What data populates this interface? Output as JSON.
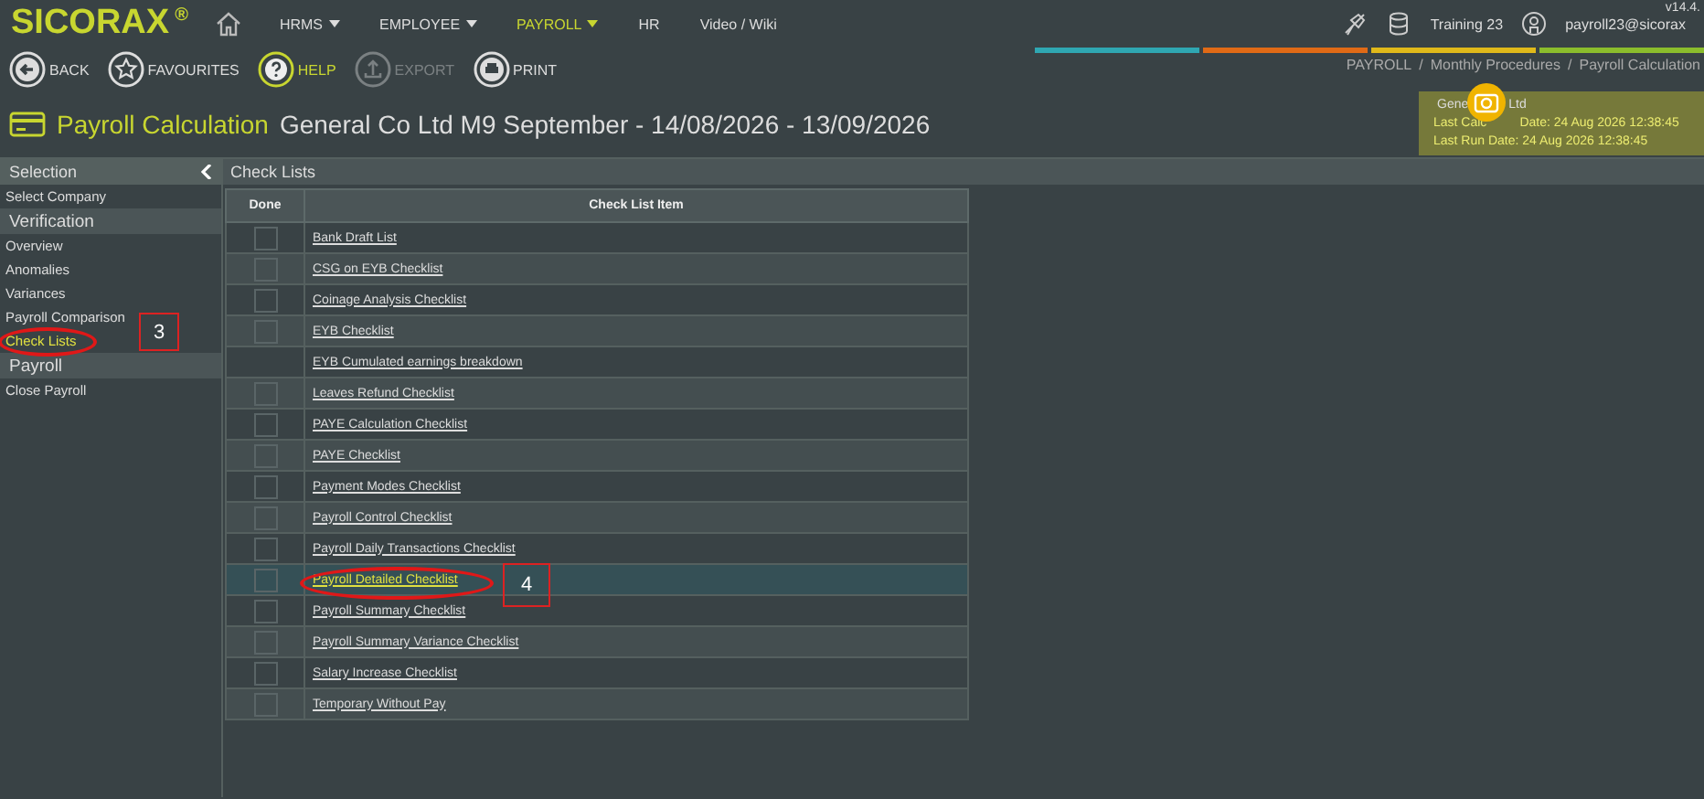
{
  "brand": {
    "name": "SICORAX",
    "mark": "®"
  },
  "nav": [
    {
      "label": "HRMS",
      "dropdown": true,
      "selected": false
    },
    {
      "label": "EMPLOYEE",
      "dropdown": true,
      "selected": false
    },
    {
      "label": "PAYROLL",
      "dropdown": true,
      "selected": true
    },
    {
      "label": "HR",
      "dropdown": false,
      "selected": false
    },
    {
      "label": "Video / Wiki",
      "dropdown": false,
      "selected": false
    }
  ],
  "status": {
    "version": "v14.4.",
    "database": "Training 23",
    "user": "payroll23@sicorax"
  },
  "toolbar": [
    {
      "kind": "back",
      "label": "BACK",
      "disabled": false,
      "selected": false
    },
    {
      "kind": "favourites",
      "label": "FAVOURITES",
      "disabled": false,
      "selected": false
    },
    {
      "kind": "help",
      "label": "HELP",
      "disabled": false,
      "selected": true
    },
    {
      "kind": "export",
      "label": "EXPORT",
      "disabled": true,
      "selected": false
    },
    {
      "kind": "print",
      "label": "PRINT",
      "disabled": false,
      "selected": false
    }
  ],
  "breadcrumb": [
    {
      "label": "PAYROLL",
      "separator": "/"
    },
    {
      "label": "Monthly Procedures",
      "separator": "/"
    },
    {
      "label": "Payroll Calculation"
    }
  ],
  "page": {
    "title": "Payroll Calculation",
    "subtitle": "General Co Ltd M9 September - 14/08/2026 - 13/09/2026"
  },
  "info_card": {
    "line_1": [
      "Gene",
      "Ltd"
    ],
    "line_2": [
      "Last Calc",
      "Date: 24 Aug 2026 12:38:45"
    ],
    "line_3": "Last Run Date: 24 Aug 2026 12:38:45"
  },
  "sidebar": {
    "title": "Selection",
    "items": [
      {
        "kind": "link",
        "label": "Select Company",
        "selected": false
      },
      {
        "kind": "header",
        "label": "Verification"
      },
      {
        "kind": "link",
        "label": "Overview",
        "selected": false
      },
      {
        "kind": "link",
        "label": "Anomalies",
        "selected": false
      },
      {
        "kind": "link",
        "label": "Variances",
        "selected": false
      },
      {
        "kind": "link",
        "label": "Payroll Comparison",
        "selected": false
      },
      {
        "kind": "link",
        "label": "Check Lists",
        "selected": true,
        "annotation": "3"
      },
      {
        "kind": "header",
        "label": "Payroll"
      },
      {
        "kind": "link",
        "label": "Close Payroll",
        "selected": false
      }
    ]
  },
  "checklists": {
    "title": "Check Lists",
    "columns": [
      "Done",
      "Check List Item"
    ],
    "rows": [
      {
        "kind": "check",
        "done": false,
        "item": "Bank Draft List",
        "selected": false
      },
      {
        "kind": "check",
        "done": false,
        "item": "CSG on EYB Checklist",
        "selected": false
      },
      {
        "kind": "check",
        "done": false,
        "item": "Coinage Analysis Checklist",
        "selected": false
      },
      {
        "kind": "check",
        "done": false,
        "item": "EYB Checklist",
        "selected": false
      },
      {
        "kind": "plain",
        "item": "EYB Cumulated earnings breakdown",
        "selected": false
      },
      {
        "kind": "check",
        "done": false,
        "item": "Leaves Refund Checklist",
        "selected": false
      },
      {
        "kind": "check",
        "done": false,
        "item": "PAYE Calculation Checklist",
        "selected": false
      },
      {
        "kind": "check",
        "done": false,
        "item": "PAYE Checklist",
        "selected": false
      },
      {
        "kind": "check",
        "done": false,
        "item": "Payment Modes Checklist",
        "selected": false
      },
      {
        "kind": "check",
        "done": false,
        "item": "Payroll Control Checklist",
        "selected": false
      },
      {
        "kind": "check",
        "done": false,
        "item": "Payroll Daily Transactions Checklist",
        "selected": false
      },
      {
        "kind": "check",
        "done": false,
        "item": "Payroll Detailed Checklist",
        "selected": true,
        "annotation": "4"
      },
      {
        "kind": "check",
        "done": false,
        "item": "Payroll Summary Checklist",
        "selected": false
      },
      {
        "kind": "check",
        "done": false,
        "item": "Payroll Summary Variance Checklist",
        "selected": false
      },
      {
        "kind": "check",
        "done": false,
        "item": "Salary Increase Checklist",
        "selected": false
      },
      {
        "kind": "check",
        "done": false,
        "item": "Temporary Without Pay",
        "selected": false
      }
    ]
  }
}
